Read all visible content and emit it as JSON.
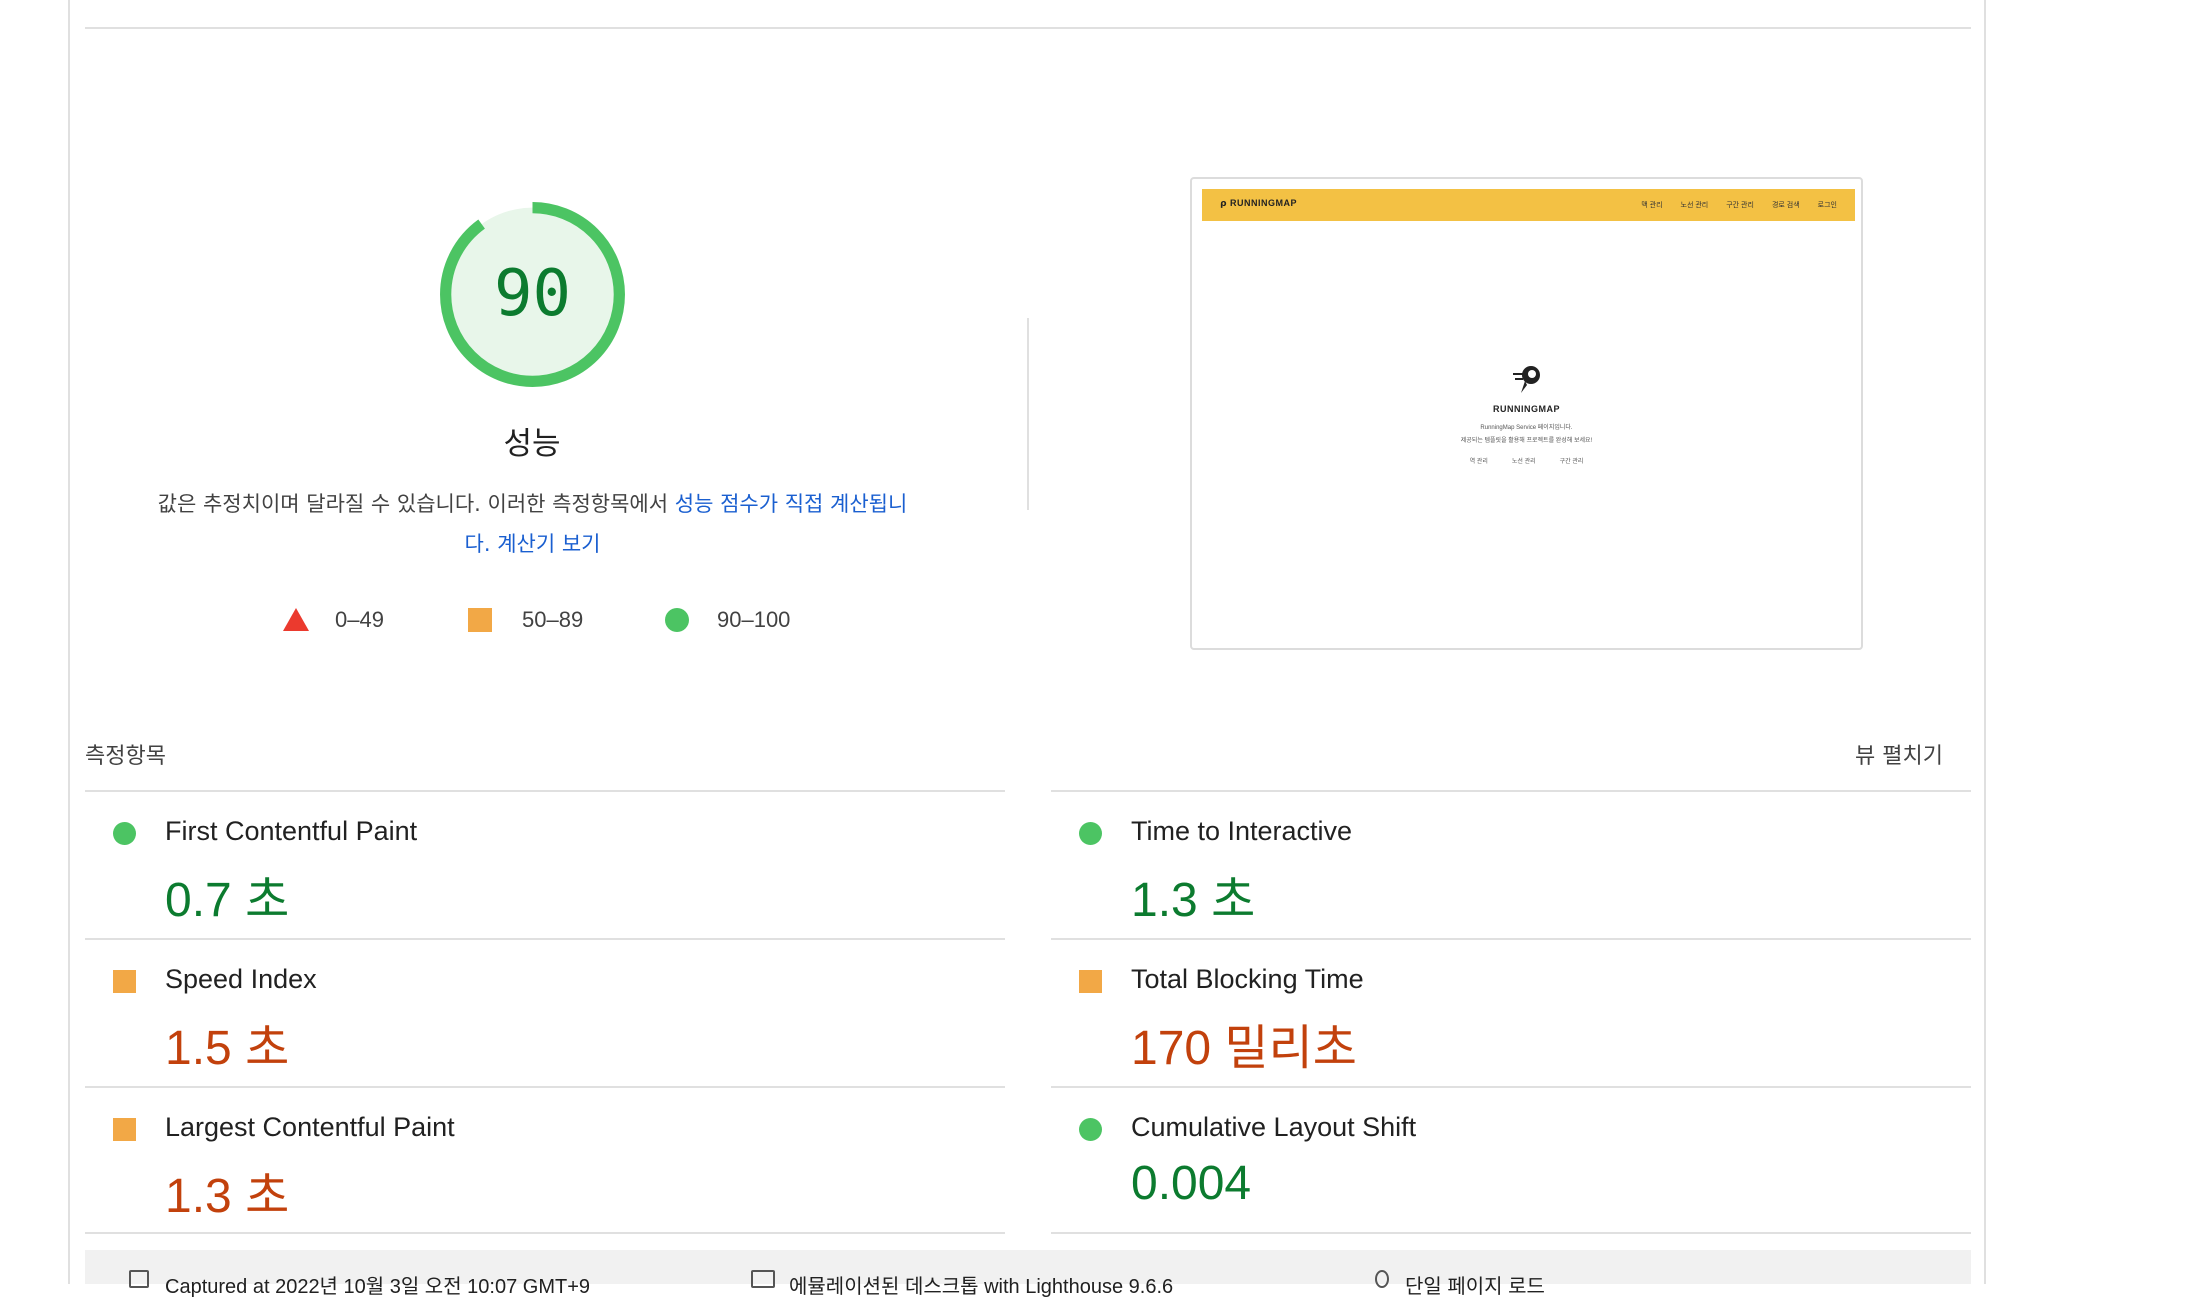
{
  "performance": {
    "score": "90",
    "score_fraction": 0.9,
    "label": "성능",
    "description_prefix": "값은 추정치이며 달라질 수 있습니다. 이러한 측정항목에서 ",
    "description_link1": "성능 점수가 직접 계산됩니",
    "description_link2": "다.",
    "description_link3": "계산기 보기",
    "colors": {
      "good": "#0c7b2f",
      "good_ring": "#4cc463",
      "average": "#f2a846",
      "fail": "#eb3a2e"
    }
  },
  "legend": [
    {
      "shape": "triangle",
      "range": "0–49"
    },
    {
      "shape": "square",
      "range": "50–89"
    },
    {
      "shape": "circle",
      "range": "90–100"
    }
  ],
  "thumbnail": {
    "logo": "RUNNINGMAP",
    "nav": [
      "맥 관리",
      "노선 관리",
      "구간 관리",
      "경로 검색",
      "로그인"
    ],
    "brand": "RUNNINGMAP",
    "line1": "RunningMap Service 페이지입니다.",
    "line2": "제공되는 템플릿을 활용해 프로젝트를 완성해 보세요!",
    "links": [
      "역 관리",
      "노선 관리",
      "구간 관리"
    ]
  },
  "metrics": {
    "header": "측정항목",
    "expand_label": "뷰 펼치기",
    "items": [
      {
        "name": "First Contentful Paint",
        "value": "0.7 초",
        "status": "good"
      },
      {
        "name": "Time to Interactive",
        "value": "1.3 초",
        "status": "good"
      },
      {
        "name": "Speed Index",
        "value": "1.5 초",
        "status": "average"
      },
      {
        "name": "Total Blocking Time",
        "value": "170 밀리초",
        "status": "average"
      },
      {
        "name": "Largest Contentful Paint",
        "value": "1.3 초",
        "status": "average"
      },
      {
        "name": "Cumulative Layout Shift",
        "value": "0.004",
        "status": "good"
      }
    ]
  },
  "footer": {
    "captured": "Captured at 2022년 10월 3일 오전 10:07 GMT+9",
    "device": "에뮬레이션된 데스크톱 with Lighthouse 9.6.6",
    "session": "단일 페이지 로드"
  }
}
